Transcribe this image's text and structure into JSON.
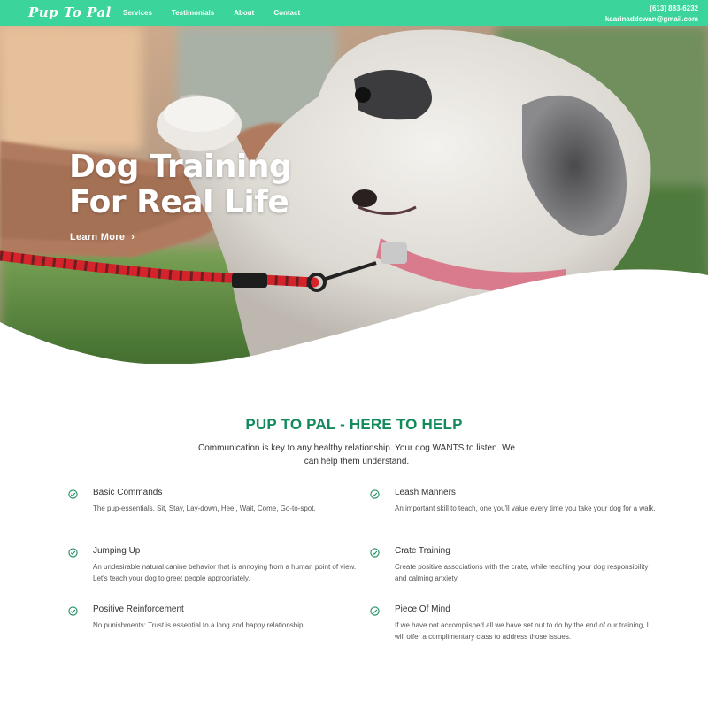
{
  "nav": {
    "logo": "Pup To Pal",
    "links": [
      "Services",
      "Testimonials",
      "About",
      "Contact"
    ],
    "phone": "(613) 883-6232",
    "email": "kaarinaddewan@gmail.com"
  },
  "hero": {
    "title_line1": "Dog Training",
    "title_line2": "For Real Life",
    "cta": "Learn More"
  },
  "help": {
    "title": "PUP TO PAL - HERE TO HELP",
    "intro": "Communication is key to any healthy relationship. Your dog WANTS to listen. We can help them understand.",
    "features": [
      {
        "title": "Basic Commands",
        "text": "The pup-essentials. Sit, Stay, Lay-down, Heel, Wait, Come, Go-to-spot."
      },
      {
        "title": "Leash Manners",
        "text": "An important skill to teach, one you'll value every time you take your dog for a walk."
      },
      {
        "title": "Jumping Up",
        "text": "An undesirable natural canine behavior that is annoying from a human point of view. Let's teach your dog to greet people appropriately."
      },
      {
        "title": "Crate Training",
        "text": "Create positive associations with the crate, while teaching your dog responsibility and calming anxiety."
      },
      {
        "title": "Positive Reinforcement",
        "text": "No punishments: Trust is essential to a long and happy relationship."
      },
      {
        "title": "Piece Of Mind",
        "text": "If we have not accomplished all we have set out to do by the end of our training, I will offer a complimentary class to address those issues."
      }
    ]
  },
  "colors": {
    "nav": "#3bd49a",
    "heading": "#138a5c",
    "check": "#1f8a5e"
  },
  "icons": [
    "check-circle-icon",
    "chevron-right-icon"
  ]
}
